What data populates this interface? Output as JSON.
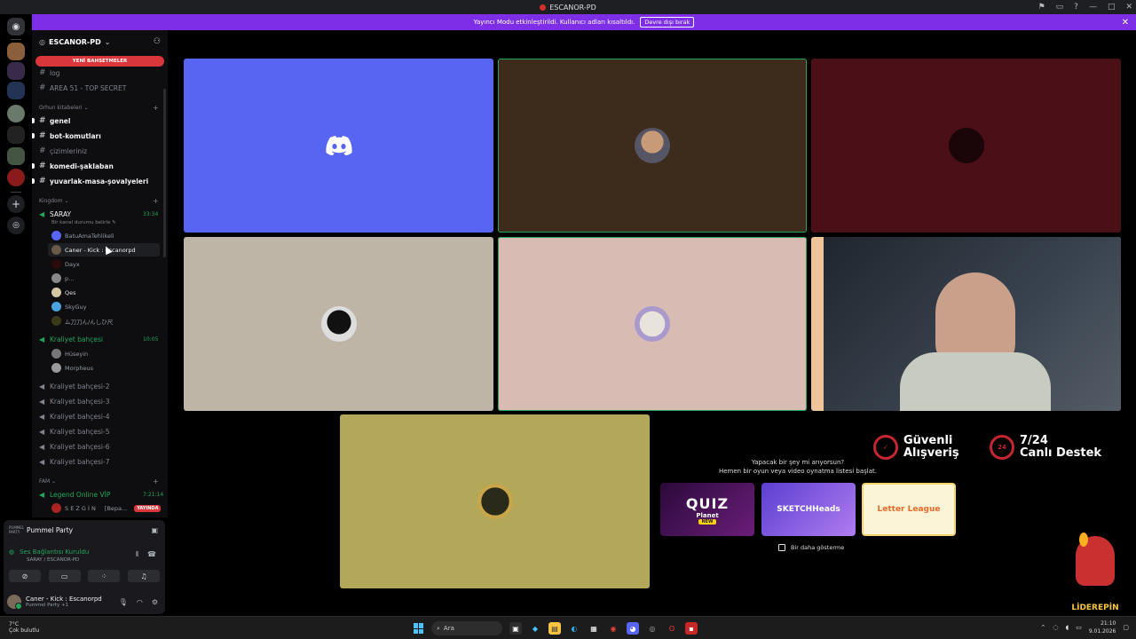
{
  "window": {
    "title": "ESCANOR-PD"
  },
  "banner": {
    "text": "Yayıncı Modu etkinleştirildi. Kullanıcı adları kısaltıldı.",
    "button": "Devre dışı bırak"
  },
  "server": {
    "name": "ESCANOR-PD",
    "new_mentions": "YENİ BAHSETMELER"
  },
  "channels": {
    "top": [
      {
        "name": "log"
      },
      {
        "name": "AREA 51 - TOP SECRET"
      }
    ],
    "category_orhun": "Orhun kitabeleri",
    "orhun": [
      {
        "name": "genel"
      },
      {
        "name": "bot-komutları"
      },
      {
        "name": "çizimleriniz"
      },
      {
        "name": "komedi-şaklaban"
      },
      {
        "name": "yuvarlak-masa-şovalyeleri"
      }
    ],
    "category_kingdom": "Kingdom",
    "saray": {
      "name": "SARAY",
      "timer": "33:34",
      "status": "Bir kanal durumu belirle"
    },
    "saray_users": [
      "BatuAmaTehlikeli",
      "Caner - Kick : Escanorpd",
      "Dayx",
      "p...",
      "Qes",
      "SkyGuy",
      "ム刀刀ん/ん乚ひ尺"
    ],
    "kraliyet": {
      "name": "Kraliyet bahçesi",
      "timer": "10:05"
    },
    "kraliyet_users": [
      "Hüseyin",
      "Morpheus"
    ],
    "kraliyet_more": [
      "Kraliyet bahçesi-2",
      "Kraliyet bahçesi-3",
      "Kraliyet bahçesi-4",
      "Kraliyet bahçesi-5",
      "Kraliyet bahçesi-6",
      "Kraliyet bahçesi-7"
    ],
    "category_fam": "FAM",
    "legend": {
      "name": "Legend Online VİP",
      "timer": "7:21:14"
    },
    "legend_user": {
      "name": "S E Z G İ N",
      "sub": "[Bepa...",
      "badge": "YAYINDA"
    }
  },
  "user_panel": {
    "activity": "Pummel Party",
    "activity_logo": "PUMMEL PARTY",
    "voice_status": "Ses Bağlantısı Kuruldu",
    "voice_channel": "SARAY / ESCANOR-PD",
    "username": "Caner - Kick : Escanorpd",
    "user_sub": "Pummel Party +1"
  },
  "promo": {
    "line1": "Yapacak bir şey mi arıyorsun?",
    "line2": "Hemen bir oyun veya video oynatma listesi başlat.",
    "games": [
      "QUIZ",
      "SKETCHHeads",
      "Letter League"
    ],
    "quiz_sub": "Planet",
    "quiz_badge": "NEW",
    "dont_show": "Bir daha gösterme"
  },
  "overlay": {
    "secure_line1": "Güvenli",
    "secure_line2": "Alışveriş",
    "support_line1": "7/24",
    "support_line2": "Canlı Destek",
    "brand": "LİDEREPİN"
  },
  "taskbar": {
    "temp": "7°C",
    "weather": "Çok bulutlu",
    "search": "Ara",
    "time": "21:10",
    "date": "9.01.2026"
  },
  "colors": {
    "accent": "#5865f2",
    "banner": "#7d2ee6",
    "speaking": "#23a55a",
    "live": "#da373c",
    "tile_blurple": "#5865f2",
    "tile_brown": "#3d2b1b",
    "tile_maroon": "#4a0f17",
    "tile_tan": "#bfb5a7",
    "tile_pink": "#d8bbb3",
    "tile_olive": "#b3a75a"
  }
}
